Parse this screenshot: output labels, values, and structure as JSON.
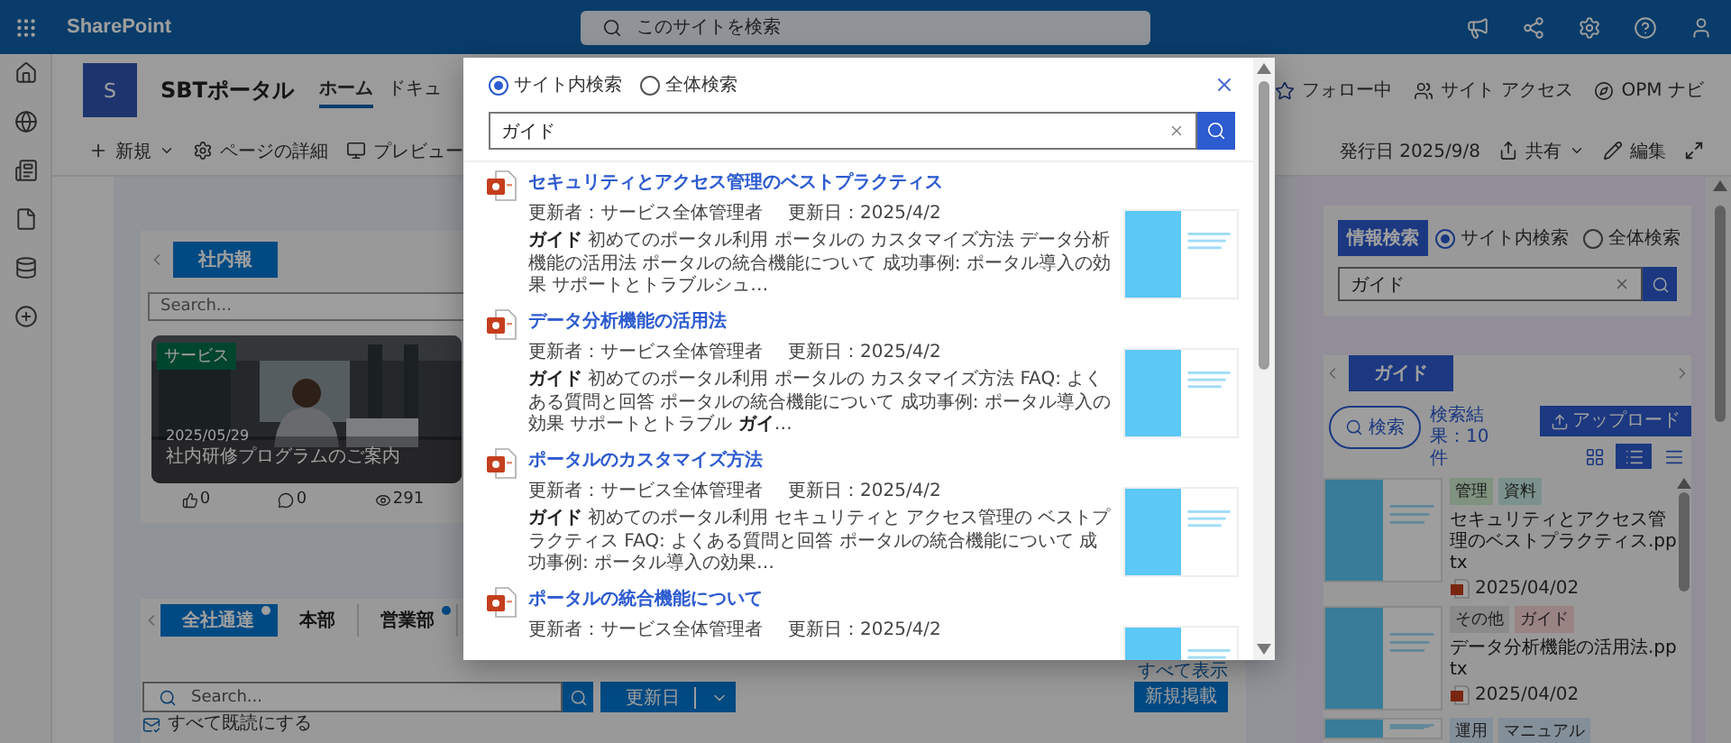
{
  "top_bar": {
    "app_name": "SharePoint",
    "search_placeholder": "このサイトを検索"
  },
  "site_header": {
    "logo_letter": "S",
    "title": "SBTポータル",
    "nav": [
      {
        "label": "ホーム",
        "selected": true
      },
      {
        "label": "ドキュ",
        "selected": false
      }
    ],
    "actions": [
      {
        "kind": "follow",
        "label": "フォロー中"
      },
      {
        "kind": "access",
        "label": "サイト アクセス"
      },
      {
        "kind": "navi",
        "label": "OPM ナビ"
      }
    ]
  },
  "command_bar": {
    "left": [
      {
        "kind": "new",
        "label": "新規"
      },
      {
        "kind": "details",
        "label": "ページの詳細"
      },
      {
        "kind": "preview",
        "label": "プレビュー"
      }
    ],
    "published": "発行日 2025/9/8",
    "right": [
      {
        "kind": "share",
        "label": "共有"
      },
      {
        "kind": "edit",
        "label": "編集"
      }
    ]
  },
  "news": {
    "tab": "社内報",
    "search_placeholder": "Search...",
    "card": {
      "tag": "サービス",
      "date": "2025/05/29",
      "title": "社内研修プログラムのご案内",
      "likes": "0",
      "comments": "0",
      "views": "291"
    }
  },
  "notices": {
    "tabs": [
      {
        "label": "全社通達",
        "selected": true,
        "unread": true
      },
      {
        "label": "本部",
        "selected": false,
        "unread": false
      },
      {
        "label": "営業部",
        "selected": false,
        "unread": true
      }
    ],
    "show_all": "すべて表示",
    "search_placeholder": "Search...",
    "sort": "更新日",
    "new_post": "新規掲載",
    "mark_all_read": "すべて既読にする"
  },
  "right_panel": {
    "search": {
      "badge": "情報検索",
      "scopes": [
        {
          "label": "サイト内検索",
          "selected": true
        },
        {
          "label": "全体検索",
          "selected": false
        }
      ],
      "value": "ガイド"
    },
    "results": {
      "tab": "ガイド",
      "search_button": "検索",
      "count": "検索結果：10件",
      "upload": "アップロード",
      "views": [
        {
          "kind": "grid",
          "selected": false
        },
        {
          "kind": "list",
          "selected": true
        },
        {
          "kind": "compact",
          "selected": false
        }
      ],
      "items": [
        {
          "tags": [
            {
              "label": "管理",
              "color": "#809280"
            },
            {
              "label": "資料",
              "color": "#7b928c"
            }
          ],
          "title": "セキュリティとアクセス管理のベストプラクティス.pptx",
          "date": "2025/04/02"
        },
        {
          "tags": [
            {
              "label": "その他",
              "color": "#8b8b8b"
            },
            {
              "label": "ガイド",
              "color": "#9a8383"
            }
          ],
          "title": "データ分析機能の活用法.pptx",
          "date": "2025/04/02"
        },
        {
          "tags": [
            {
              "label": "運用",
              "color": "#838f99"
            },
            {
              "label": "マニュアル",
              "color": "#838f99"
            }
          ]
        }
      ]
    }
  },
  "search_dialog": {
    "scopes": [
      {
        "label": "サイト内検索",
        "selected": true
      },
      {
        "label": "全体検索",
        "selected": false
      }
    ],
    "query": "ガイド",
    "results": [
      {
        "title": "セキュリティとアクセス管理のベストプラクティス",
        "updater": "更新者：サービス全体管理者",
        "updated": "更新日：2025/4/2",
        "snippet": "**ガイド** 初めてのポータル利用 ポータルの カスタマイズ方法 データ分析機能の活用法 ポータルの統合機能について 成功事例: ポータル導入の効果 サポートとトラブルシュ…"
      },
      {
        "title": "データ分析機能の活用法",
        "updater": "更新者：サービス全体管理者",
        "updated": "更新日：2025/4/2",
        "snippet": "**ガイド** 初めてのポータル利用 ポータルの カスタマイズ方法 FAQ: よくある質問と回答 ポータルの統合機能について 成功事例: ポータル導入の効果 サポートとトラブル **ガイ**…"
      },
      {
        "title": "ポータルのカスタマイズ方法",
        "updater": "更新者：サービス全体管理者",
        "updated": "更新日：2025/4/2",
        "snippet": "**ガイド** 初めてのポータル利用 セキュリティと アクセス管理の ベストプラクティス FAQ: よくある質問と回答 ポータルの統合機能について 成功事例: ポータル導入の効果…"
      },
      {
        "title": "ポータルの統合機能について",
        "updater": "更新者：サービス全体管理者",
        "updated": "更新日：2025/4/2"
      }
    ]
  }
}
